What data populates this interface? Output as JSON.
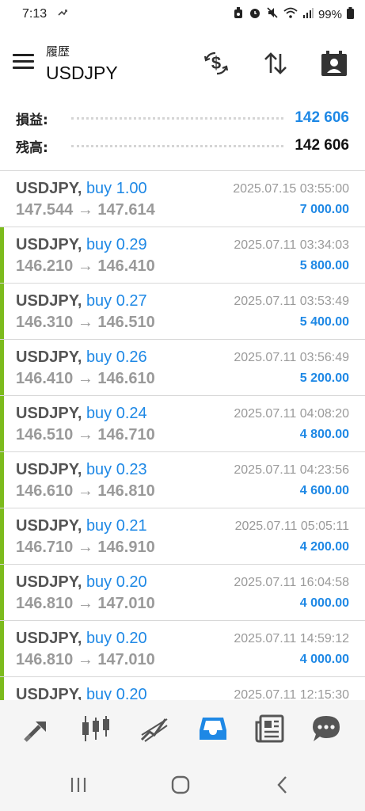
{
  "status_bar": {
    "time": "7:13",
    "battery": "99%",
    "left_icon": "missed-call-icon",
    "right_icons": [
      "alarm-icon",
      "clock-icon",
      "mute-icon",
      "wifi-icon",
      "signal-icon",
      "battery-icon"
    ]
  },
  "header": {
    "subtitle": "履歴",
    "title": "USDJPY",
    "icons": [
      "currency-exchange-icon",
      "sort-icon",
      "calendar-person-icon"
    ]
  },
  "summary": {
    "profit_label": "損益:",
    "profit_value": "142 606",
    "balance_label": "残高:",
    "balance_value": "142 606",
    "profit_color": "#1e88e5"
  },
  "trades": [
    {
      "symbol": "USDJPY,",
      "side": "buy 1.00",
      "prices": "147.544 → 147.614",
      "date": "2025.07.15 03:55:00",
      "profit": "7 000.00",
      "marked": false
    },
    {
      "symbol": "USDJPY,",
      "side": "buy 0.29",
      "prices": "146.210 → 146.410",
      "date": "2025.07.11 03:34:03",
      "profit": "5 800.00",
      "marked": true
    },
    {
      "symbol": "USDJPY,",
      "side": "buy 0.27",
      "prices": "146.310 → 146.510",
      "date": "2025.07.11 03:53:49",
      "profit": "5 400.00",
      "marked": true
    },
    {
      "symbol": "USDJPY,",
      "side": "buy 0.26",
      "prices": "146.410 → 146.610",
      "date": "2025.07.11 03:56:49",
      "profit": "5 200.00",
      "marked": true
    },
    {
      "symbol": "USDJPY,",
      "side": "buy 0.24",
      "prices": "146.510 → 146.710",
      "date": "2025.07.11 04:08:20",
      "profit": "4 800.00",
      "marked": true
    },
    {
      "symbol": "USDJPY,",
      "side": "buy 0.23",
      "prices": "146.610 → 146.810",
      "date": "2025.07.11 04:23:56",
      "profit": "4 600.00",
      "marked": true
    },
    {
      "symbol": "USDJPY,",
      "side": "buy 0.21",
      "prices": "146.710 → 146.910",
      "date": "2025.07.11 05:05:11",
      "profit": "4 200.00",
      "marked": true
    },
    {
      "symbol": "USDJPY,",
      "side": "buy 0.20",
      "prices": "146.810 → 147.010",
      "date": "2025.07.11 16:04:58",
      "profit": "4 000.00",
      "marked": true
    },
    {
      "symbol": "USDJPY,",
      "side": "buy 0.20",
      "prices": "146.810 → 147.010",
      "date": "2025.07.11 14:59:12",
      "profit": "4 000.00",
      "marked": true
    },
    {
      "symbol": "USDJPY,",
      "side": "buy 0.20",
      "prices": "",
      "date": "2025.07.11 12:15:30",
      "profit": "",
      "marked": true
    }
  ],
  "bottom_nav": {
    "items": [
      "trade-icon",
      "chart-candles-icon",
      "trend-lines-icon",
      "history-inbox-icon",
      "news-icon",
      "chat-icon"
    ],
    "active": "history-inbox-icon",
    "active_color": "#1e88e5",
    "inactive_color": "#555555"
  },
  "system_nav": [
    "recent-apps-icon",
    "home-icon",
    "back-icon"
  ]
}
